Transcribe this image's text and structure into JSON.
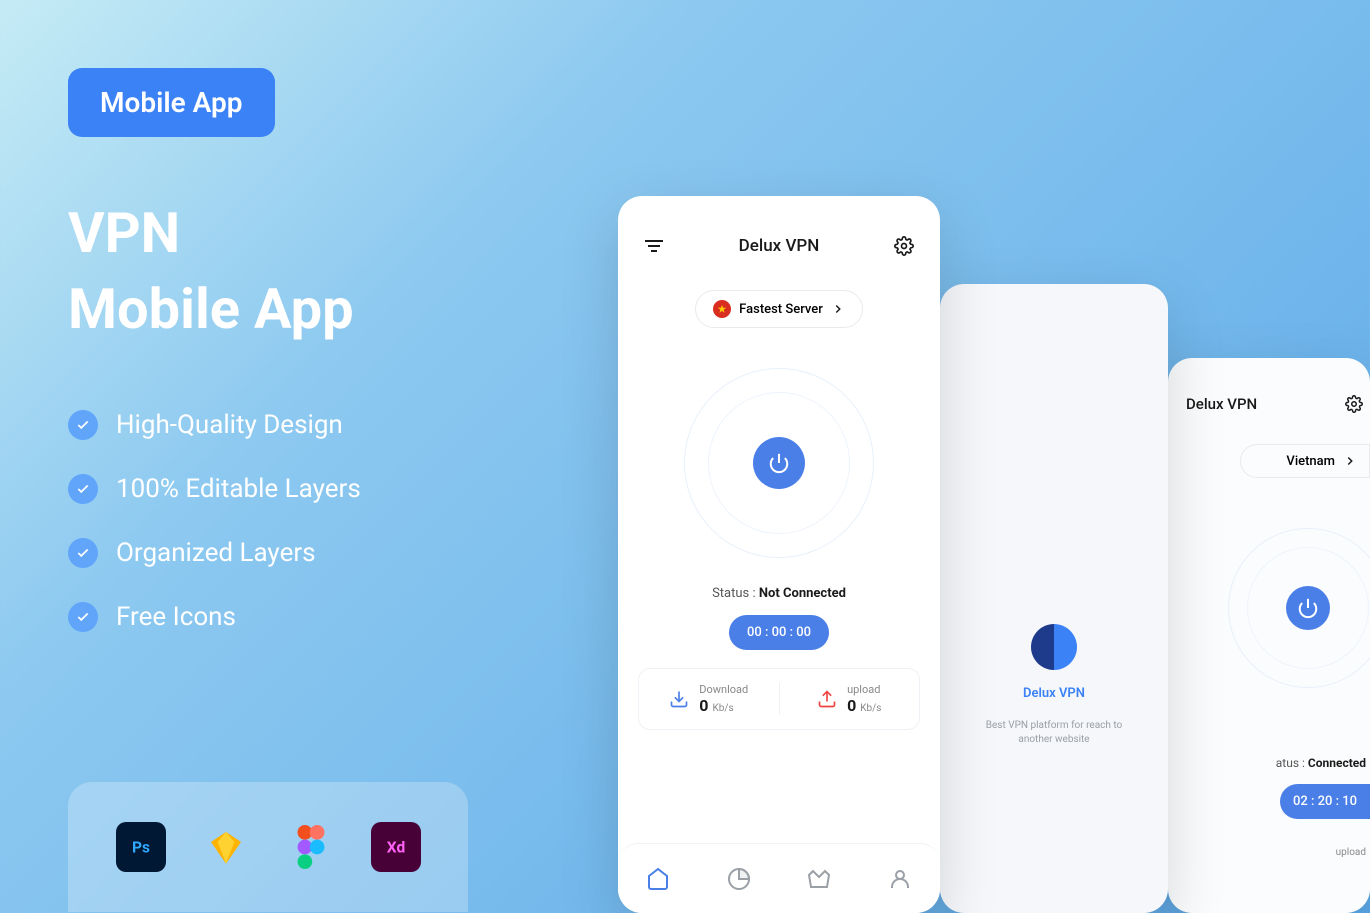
{
  "badge": "Mobile App",
  "title_line1": "VPN",
  "title_line2": "Mobile App",
  "features": [
    "High-Quality Design",
    "100% Editable Layers",
    "Organized Layers",
    "Free Icons"
  ],
  "tools": [
    "photoshop",
    "sketch",
    "figma",
    "xd"
  ],
  "phone1": {
    "app_title": "Delux VPN",
    "server_label": "Fastest Server",
    "status_prefix": "Status : ",
    "status_value": "Not Connected",
    "timer": "00 : 00 : 00",
    "download": {
      "label": "Download",
      "value": "0",
      "unit": "Kb/s"
    },
    "upload": {
      "label": "upload",
      "value": "0",
      "unit": "Kb/s"
    }
  },
  "phone2": {
    "app_title": "Delux VPN",
    "tagline": "Best VPN platform for reach to another website"
  },
  "phone3": {
    "app_title": "Delux VPN",
    "server_label": "Vietnam",
    "status_prefix": "atus : ",
    "status_value": "Connected",
    "timer": "02 : 20 : 10",
    "upload_label": "upload"
  }
}
